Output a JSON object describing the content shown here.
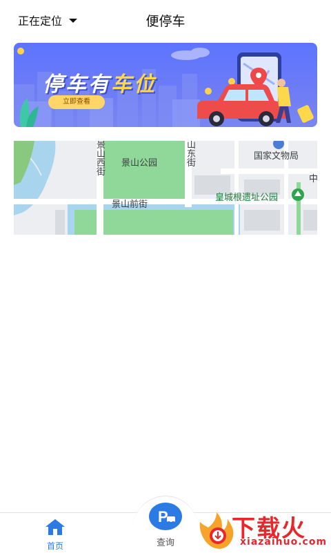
{
  "header": {
    "location_label": "正在定位",
    "title": "便停车"
  },
  "banner": {
    "title_part1": "停车有",
    "title_part2": "车位",
    "button_label": "立即查看"
  },
  "map": {
    "labels": {
      "jingshan_park": "景山公园",
      "jingshan_west": "景山西街",
      "jingshan_east": "山东街",
      "national_cultural_heritage": "国家文物局",
      "huangcheng_park": "皇城根遗址公园",
      "jingshan_front": "景山前街",
      "zhong": "中"
    }
  },
  "tabbar": {
    "home_label": "首页",
    "query_label": "查询",
    "parking_glyph": "P"
  },
  "watermark": {
    "text": "下载火",
    "url": "xiazaihuo.com"
  },
  "colors": {
    "accent": "#2c7be5",
    "banner": "#5c74ff",
    "watermark": "#e8262b"
  }
}
